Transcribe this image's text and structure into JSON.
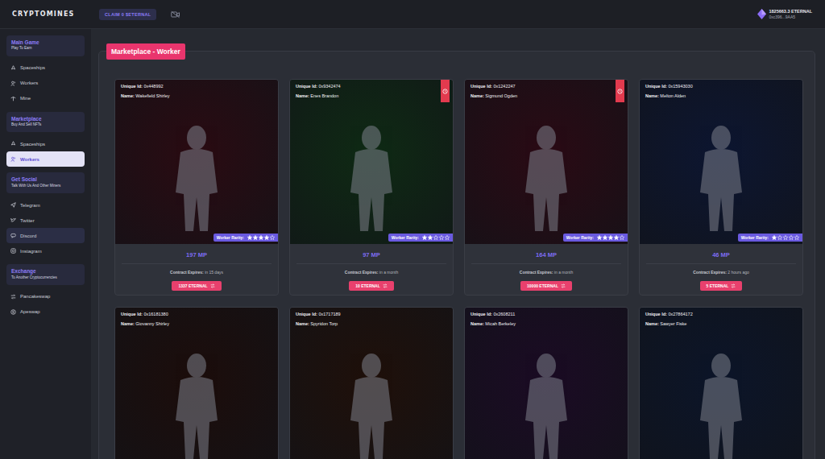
{
  "header": {
    "logo": "CRYPTOMINES",
    "claim_button": "CLAIM 0 $ETERNAL",
    "balance": "1825663.3 ETERNAL",
    "address": "0xc396...9AA5"
  },
  "sidebar": {
    "sections": [
      {
        "title": "Main Game",
        "subtitle": "Play To Earn",
        "items": [
          {
            "label": "Spaceships",
            "selected": false,
            "hovered": false
          },
          {
            "label": "Workers",
            "selected": false,
            "hovered": false
          },
          {
            "label": "Mine",
            "selected": false,
            "hovered": false
          }
        ]
      },
      {
        "title": "Marketplace",
        "subtitle": "Buy And Sell NFTs",
        "items": [
          {
            "label": "Spaceships",
            "selected": false,
            "hovered": false
          },
          {
            "label": "Workers",
            "selected": true,
            "hovered": false
          }
        ]
      },
      {
        "title": "Get Social",
        "subtitle": "Talk With Us And Other Miners",
        "items": [
          {
            "label": "Telegram",
            "selected": false,
            "hovered": false
          },
          {
            "label": "Twitter",
            "selected": false,
            "hovered": false
          },
          {
            "label": "Discord",
            "selected": false,
            "hovered": true
          },
          {
            "label": "Instagram",
            "selected": false,
            "hovered": false
          }
        ]
      },
      {
        "title": "Exchange",
        "subtitle": "To Another Cryptocurrencies",
        "items": [
          {
            "label": "Pancakeswap",
            "selected": false,
            "hovered": false
          },
          {
            "label": "Apeswap",
            "selected": false,
            "hovered": false
          }
        ]
      }
    ]
  },
  "page": {
    "title": "Marketplace - Worker"
  },
  "card_labels": {
    "unique_id": "Unique Id:",
    "name": "Name:",
    "rarity": "Worker Rarity:",
    "expires": "Contract Expires:"
  },
  "workers": [
    {
      "id": "0x448992",
      "name": "Wakefield Shirley",
      "stars": 4,
      "timer": false,
      "mp": "197 MP",
      "expires": "in 15 days",
      "price": "1337 ETERNAL",
      "color": "#2a0b12"
    },
    {
      "id": "0x9342474",
      "name": "Enes Brandon",
      "stars": 2,
      "timer": true,
      "mp": "97 MP",
      "expires": "in a month",
      "price": "10 ETERNAL",
      "color": "#0f2a14"
    },
    {
      "id": "0x1242247",
      "name": "Sigmund Ogden",
      "stars": 4,
      "timer": true,
      "mp": "164 MP",
      "expires": "in a month",
      "price": "10000 ETERNAL",
      "color": "#2a0a14"
    },
    {
      "id": "0x15943030",
      "name": "Melton Alden",
      "stars": 1,
      "timer": false,
      "mp": "46 MP",
      "expires": "2 hours ago",
      "price": "5 ETERNAL",
      "color": "#0d1631"
    },
    {
      "id": "0x16181380",
      "name": "Giovanny Shirley",
      "timer": false,
      "color": "#1c0d0b"
    },
    {
      "id": "0x1717189",
      "name": "Spyridon Torp",
      "timer": false,
      "color": "#1f100a"
    },
    {
      "id": "0x2608211",
      "name": "Micah Berkeley",
      "timer": false,
      "color": "#1b0b24"
    },
    {
      "id": "0x27864172",
      "name": "Sawyer Fiske",
      "timer": false,
      "color": "#0c1529"
    }
  ]
}
